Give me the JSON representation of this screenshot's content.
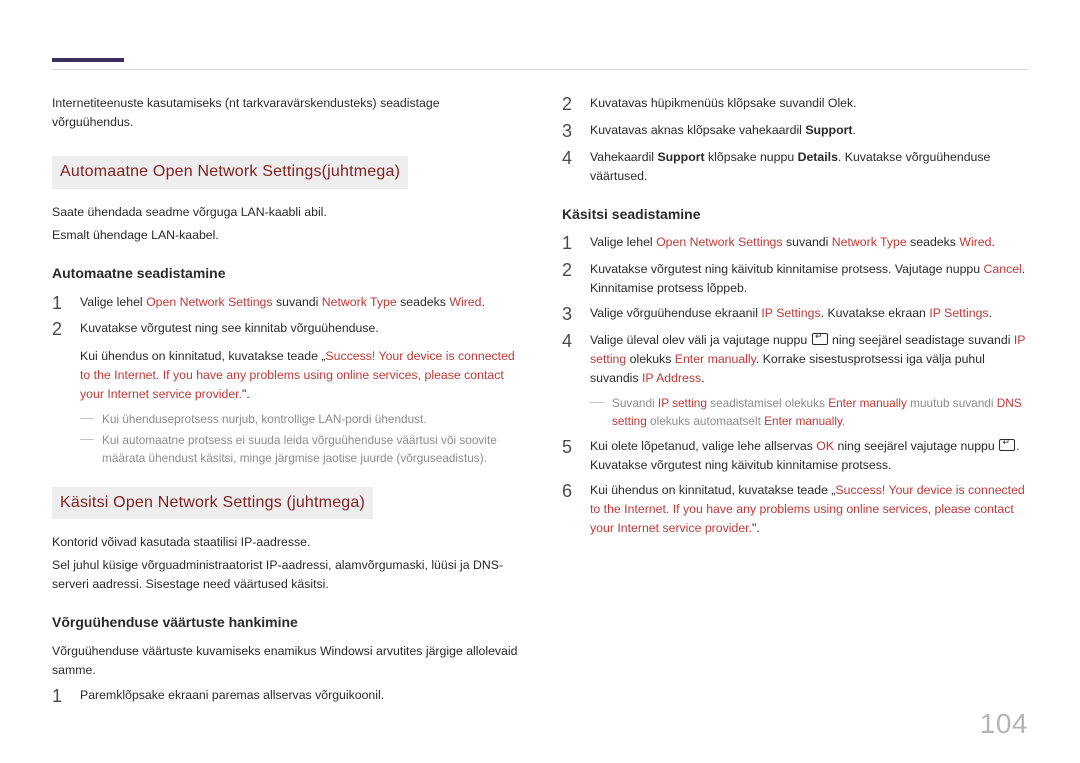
{
  "page_number": "104",
  "left": {
    "intro": "Internetiteenuste kasutamiseks (nt tarkvaravärskendusteks) seadistage võrguühendus.",
    "h2_automatic": "Automaatne  Open Network Settings(juhtmega)",
    "p1": "Saate ühendada seadme võrguga LAN-kaabli abil.",
    "p2": "Esmalt ühendage LAN-kaabel.",
    "h3_auto": "Automaatne seadistamine",
    "step1": {
      "pre": "Valige lehel ",
      "red1": "Open Network Settings",
      "mid1": " suvandi ",
      "red2": "Network Type",
      "mid2": " seadeks ",
      "red3": "Wired",
      "post": "."
    },
    "step2_a": "Kuvatakse võrgutest ning see kinnitab võrguühenduse.",
    "step2_b_pre": "Kui ühendus on kinnitatud, kuvatakse teade „",
    "step2_b_red": "Success! Your device is connected to the Internet. If you have any problems using online services, please contact your Internet service provider.",
    "step2_b_post": "\".",
    "note1": "Kui ühenduseprotsess nurjub, kontrollige LAN-pordi ühendust.",
    "note2": "Kui automaatne protsess ei suuda leida võrguühenduse väärtusi või soovite määrata ühendust käsitsi, minge järgmise jaotise juurde (võrguseadistus).",
    "h2_manual": "Käsitsi Open Network Settings (juhtmega)",
    "m_p1": "Kontorid võivad kasutada staatilisi IP-aadresse.",
    "m_p2": "Sel juhul küsige võrguadministraatorist IP-aadressi, alamvõrgumaski, lüüsi ja DNS-serveri aadressi. Sisestage need väärtused käsitsi.",
    "h3_values": "Võrguühenduse väärtuste hankimine",
    "values_p": "Võrguühenduse väärtuste kuvamiseks enamikus Windowsi arvutites järgige allolevaid samme.",
    "values_step1": "Paremklõpsake ekraani paremas allservas võrguikoonil."
  },
  "right": {
    "s2": "Kuvatavas hüpikmenüüs klõpsake suvandil Olek.",
    "s3_pre": "Kuvatavas aknas klõpsake vahekaardil ",
    "s3_bold": "Support",
    "s3_post": ".",
    "s4_pre": "Vahekaardil ",
    "s4_b1": "Support",
    "s4_mid": " klõpsake nuppu ",
    "s4_b2": "Details",
    "s4_post": ". Kuvatakse võrguühenduse väärtused.",
    "h3_manual": "Käsitsi seadistamine",
    "m1": {
      "pre": "Valige lehel ",
      "red1": "Open Network Settings",
      "mid1": " suvandi ",
      "red2": "Network Type",
      "mid2": " seadeks ",
      "red3": "Wired",
      "post": "."
    },
    "m2_pre": "Kuvatakse võrgutest ning käivitub kinnitamise protsess. Vajutage nuppu ",
    "m2_red": "Cancel",
    "m2_post": ". Kinnitamise protsess lõppeb.",
    "m3_pre": "Valige võrguühenduse ekraanil ",
    "m3_red1": "IP Settings",
    "m3_mid": ". Kuvatakse ekraan ",
    "m3_red2": "IP Settings",
    "m3_post": ".",
    "m4_pre": "Valige üleval olev väli ja vajutage nuppu ",
    "m4_mid1": " ning seejärel seadistage suvandi ",
    "m4_red1": "IP setting",
    "m4_mid2": " olekuks ",
    "m4_red2": "Enter manually",
    "m4_mid3": ". Korrake sisestusprotsessi iga välja puhul suvandis ",
    "m4_red3": "IP Address",
    "m4_post": ".",
    "m4_note_pre": "Suvandi ",
    "m4_note_r1": "IP setting",
    "m4_note_mid1": " seadistamisel olekuks ",
    "m4_note_r2": "Enter manually",
    "m4_note_mid2": " muutub suvandi ",
    "m4_note_r3": "DNS setting",
    "m4_note_mid3": " olekuks automaatselt ",
    "m4_note_r4": "Enter manually",
    "m4_note_post": ".",
    "m5_pre": "Kui olete lõpetanud, valige lehe allservas ",
    "m5_red": "OK",
    "m5_mid": " ning seejärel vajutage nuppu ",
    "m5_post": ". Kuvatakse võrgutest ning käivitub kinnitamise protsess.",
    "m6_pre": "Kui ühendus on kinnitatud, kuvatakse teade „",
    "m6_red": "Success! Your device is connected to the Internet. If you have any problems using online services, please contact your Internet service provider.",
    "m6_post": "\"."
  }
}
